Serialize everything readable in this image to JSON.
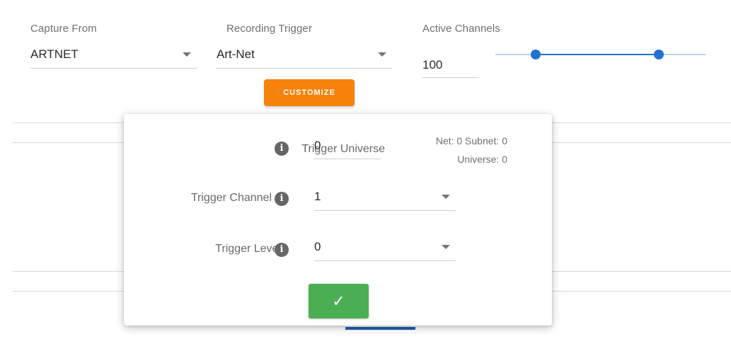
{
  "capture": {
    "label": "Capture From",
    "value": "ARTNET"
  },
  "recording_trigger": {
    "label": "Recording Trigger",
    "value": "Art-Net",
    "customize_label": "CUSTOMIZE"
  },
  "active_channels": {
    "label": "Active Channels",
    "value": "100",
    "slider_range": [
      0.2,
      0.78
    ]
  },
  "dialog": {
    "trigger_universe": {
      "label": "Trigger Universe",
      "value": "0",
      "helper_line1": "Net: 0 Subnet: 0",
      "helper_line2": "Universe: 0"
    },
    "trigger_channel": {
      "label": "Trigger Channel",
      "value": "1"
    },
    "trigger_level": {
      "label": "Trigger Level",
      "value": "0"
    },
    "confirm_glyph": "✓",
    "info_glyph": "i"
  },
  "colors": {
    "accent_orange": "#f5820b",
    "confirm_green": "#4cae53",
    "slider_blue": "#1f72d3"
  }
}
